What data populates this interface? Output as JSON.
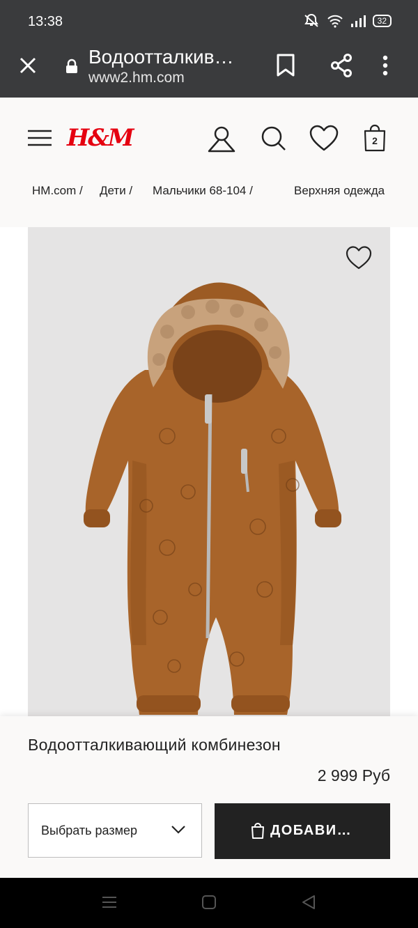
{
  "status": {
    "time": "13:38",
    "battery": "32"
  },
  "browser": {
    "page_title": "Водоотталкив…",
    "url": "www2.hm.com"
  },
  "header": {
    "logo": "H&M",
    "bag_count": "2"
  },
  "breadcrumb": [
    "HM.com /",
    "Дети /",
    "Мальчики 68-104 /",
    "Верхняя одежда"
  ],
  "product": {
    "name": "Водоотталкивающий комбинезон",
    "price": "2 999 Руб",
    "size_select_label": "Выбрать размер",
    "add_button_label": "ДОБАВИ…",
    "image_colors": {
      "fabric": "#a8642a",
      "fur": "#c8a27c",
      "background": "#e5e4e4"
    }
  },
  "icons": [
    "close-icon",
    "lock-icon",
    "bookmark-icon",
    "share-icon",
    "more-icon",
    "menu-icon",
    "account-icon",
    "search-icon",
    "heart-icon",
    "bag-icon",
    "chevron-down-icon"
  ]
}
